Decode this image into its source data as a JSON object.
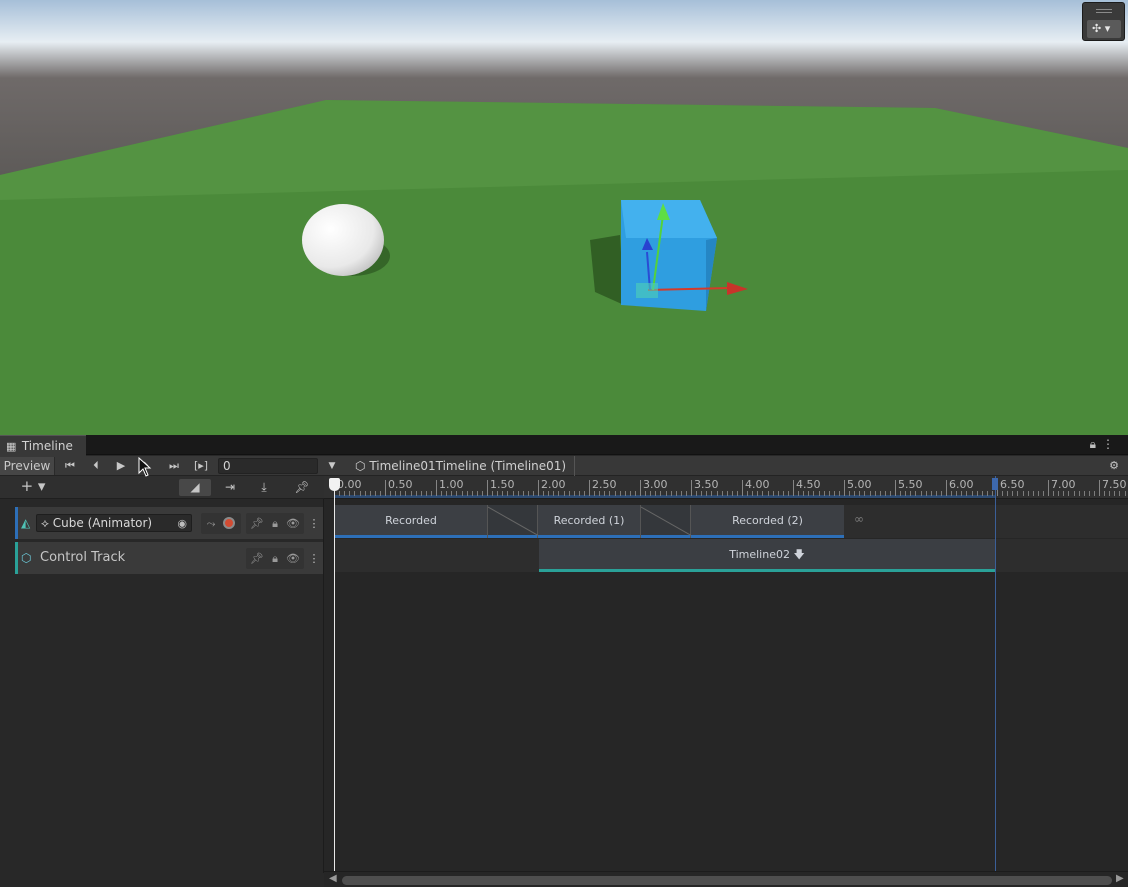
{
  "scene": {
    "gizmo_icon": "scene-orientation-gizmo-icon"
  },
  "timeline_window": {
    "tab_title": "Timeline",
    "toolbar": {
      "preview_label": "Preview",
      "frame_value": "0",
      "breadcrumb": "Timeline01Timeline (Timeline01)"
    },
    "ruler_labels": [
      "0.00",
      "0.50",
      "1.00",
      "1.50",
      "2.00",
      "2.50",
      "3.00",
      "3.50",
      "4.00",
      "4.50",
      "5.00",
      "5.50",
      "6.00",
      "6.50",
      "7.00",
      "7.50"
    ],
    "tracks": [
      {
        "binding": "Cube (Animator)",
        "accent": "#2d6fb8",
        "clips": [
          "Recorded",
          "Recorded (1)",
          "Recorded (2)"
        ],
        "infinite_glyph": "∞"
      },
      {
        "name": "Control Track",
        "accent": "#2aa198",
        "clips": [
          "Timeline02 🡇"
        ]
      }
    ]
  }
}
